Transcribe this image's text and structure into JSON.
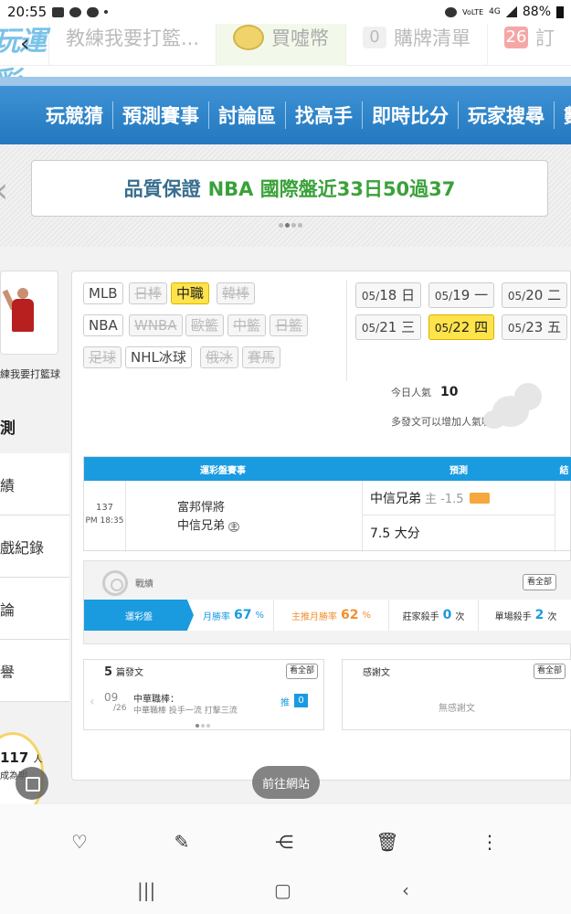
{
  "status": {
    "time": "20:55",
    "battery": "88%",
    "net1": "VoLTE",
    "net2": "4G"
  },
  "top_tabs": {
    "logo": "玩運彩",
    "tabs": [
      {
        "label": "教練我要打籃..."
      },
      {
        "label": "買噓幣"
      },
      {
        "count": "0",
        "label": "購牌清單"
      },
      {
        "count": "26",
        "label": "訂"
      }
    ]
  },
  "nav": {
    "items": [
      "玩競猜",
      "預測賽事",
      "討論區",
      "找高手",
      "即時比分",
      "玩家搜尋",
      "數"
    ]
  },
  "banner": {
    "text1": "品質保證",
    "text2": "NBA 國際盤近33日50過37"
  },
  "sidebar": {
    "name": "練我要打籃球",
    "menu_head": "測",
    "menu": [
      "績",
      "戲紀錄",
      "論",
      "譽"
    ],
    "count": "117",
    "count_unit": "人",
    "count_sub": "成為明"
  },
  "leagues": [
    {
      "label": "MLB",
      "state": "normal"
    },
    {
      "label": "日棒",
      "state": "disabled"
    },
    {
      "label": "中職",
      "state": "active"
    },
    {
      "label": "韓棒",
      "state": "disabled"
    },
    {
      "label": "NBA",
      "state": "normal"
    },
    {
      "label": "WNBA",
      "state": "disabled"
    },
    {
      "label": "歐籃",
      "state": "disabled"
    },
    {
      "label": "中籃",
      "state": "disabled"
    },
    {
      "label": "日籃",
      "state": "disabled"
    },
    {
      "label": "足球",
      "state": "disabled"
    },
    {
      "label": "NHL冰球",
      "state": "normal"
    },
    {
      "label": "俄冰",
      "state": "disabled"
    },
    {
      "label": "賽馬",
      "state": "disabled"
    }
  ],
  "dates": [
    {
      "md": "05/",
      "d": "18",
      "w": "日",
      "active": false
    },
    {
      "md": "05/",
      "d": "19",
      "w": "一",
      "active": false
    },
    {
      "md": "05/",
      "d": "20",
      "w": "二",
      "active": false
    },
    {
      "md": "05/",
      "d": "21",
      "w": "三",
      "active": false
    },
    {
      "md": "05/",
      "d": "22",
      "w": "四",
      "active": true
    },
    {
      "md": "05/",
      "d": "23",
      "w": "五",
      "active": false
    }
  ],
  "popular": {
    "label": "今日人氣",
    "value": "10",
    "note": "多發文可以增加人氣喔~"
  },
  "match_table": {
    "headers": [
      "運彩盤賽事",
      "預測",
      "結"
    ],
    "game_no": "137",
    "game_time": "PM 18:35",
    "away": "富邦悍將",
    "home": "中信兄弟",
    "home_mark": "主",
    "pick": "中信兄弟",
    "pick_line": "主 -1.5",
    "total": "7.5 大分"
  },
  "record": {
    "label": "戰績",
    "view_all": "看全部",
    "pill": "運彩盤",
    "cells": [
      {
        "label": "月勝率",
        "value": "67",
        "unit": "%"
      },
      {
        "label": "主推月勝率",
        "value": "62",
        "unit": "%"
      },
      {
        "label": "莊家殺手",
        "value": "0",
        "unit": "次"
      },
      {
        "label": "單場殺手",
        "value": "2",
        "unit": "次"
      }
    ]
  },
  "posts": {
    "count": "5",
    "title": "篇發文",
    "view_all": "看全部",
    "item": {
      "month": "09",
      "day": "26",
      "category": "中華職棒：",
      "title": "中華職棒 投手一流 打擊三流",
      "push_label": "推",
      "push_count": "0"
    }
  },
  "thanks": {
    "title": "感謝文",
    "view_all": "看全部",
    "empty": "無感謝文"
  },
  "float": {
    "go_site": "前往網站"
  },
  "toolbar": [
    "heart-icon",
    "pencil-icon",
    "share-icon",
    "trash-icon",
    "more-icon"
  ]
}
